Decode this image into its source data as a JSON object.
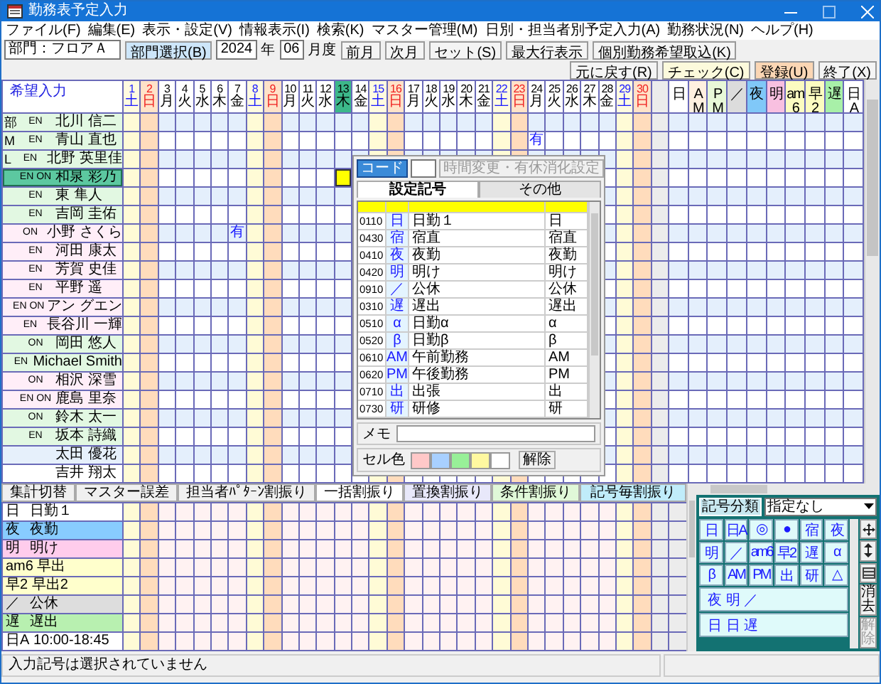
{
  "window": {
    "title": "勤務表予定入力"
  },
  "menu": [
    "ファイル(F)",
    "編集(E)",
    "表示・設定(V)",
    "情報表示(I)",
    "検索(K)",
    "マスター管理(M)",
    "日別・担当者別予定入力(A)",
    "勤務状況(N)",
    "ヘルプ(H)"
  ],
  "toolbar": {
    "department": "部門：フロアＡ",
    "department_button": {
      "label": "部門選択(B)",
      "color": "#cde6fa"
    },
    "year": "2024",
    "year_unit": "年",
    "month": "06",
    "month_unit": "月度",
    "nav_buttons": [
      "前月",
      "次月",
      "セット(S)",
      "最大行表示",
      "個別勤務希望取込(K)"
    ],
    "action_buttons": [
      {
        "label": "元に戻す(R)",
        "color": "#f4f4f4"
      },
      {
        "label": "チェック(C)",
        "color": "#fcfadc"
      },
      {
        "label": "登録(U)",
        "color": "#fbd6b4"
      },
      {
        "label": "終了(X)",
        "color": "#f4f4f4"
      }
    ]
  },
  "grid": {
    "corner_label": "希望入力",
    "days": [
      {
        "day": "1",
        "weekday": "土",
        "kind": "sat",
        "selected": false
      },
      {
        "day": "2",
        "weekday": "日",
        "kind": "sun",
        "selected": false
      },
      {
        "day": "3",
        "weekday": "月",
        "kind": "weekday",
        "selected": false
      },
      {
        "day": "4",
        "weekday": "火",
        "kind": "weekday",
        "selected": false
      },
      {
        "day": "5",
        "weekday": "水",
        "kind": "weekday",
        "selected": false
      },
      {
        "day": "6",
        "weekday": "木",
        "kind": "weekday",
        "selected": false
      },
      {
        "day": "7",
        "weekday": "金",
        "kind": "weekday",
        "selected": false
      },
      {
        "day": "8",
        "weekday": "土",
        "kind": "sat",
        "selected": false
      },
      {
        "day": "9",
        "weekday": "日",
        "kind": "sun",
        "selected": false
      },
      {
        "day": "10",
        "weekday": "月",
        "kind": "weekday",
        "selected": false
      },
      {
        "day": "11",
        "weekday": "火",
        "kind": "weekday",
        "selected": false
      },
      {
        "day": "12",
        "weekday": "水",
        "kind": "weekday",
        "selected": false
      },
      {
        "day": "13",
        "weekday": "木",
        "kind": "weekday",
        "selected": true
      },
      {
        "day": "14",
        "weekday": "金",
        "kind": "weekday",
        "selected": false
      },
      {
        "day": "15",
        "weekday": "土",
        "kind": "sat",
        "selected": false
      },
      {
        "day": "16",
        "weekday": "日",
        "kind": "sun",
        "selected": false
      },
      {
        "day": "17",
        "weekday": "月",
        "kind": "weekday",
        "selected": false
      },
      {
        "day": "18",
        "weekday": "火",
        "kind": "weekday",
        "selected": false
      },
      {
        "day": "19",
        "weekday": "水",
        "kind": "weekday",
        "selected": false
      },
      {
        "day": "20",
        "weekday": "木",
        "kind": "weekday",
        "selected": false
      },
      {
        "day": "21",
        "weekday": "金",
        "kind": "weekday",
        "selected": false
      },
      {
        "day": "22",
        "weekday": "土",
        "kind": "sat",
        "selected": false
      },
      {
        "day": "23",
        "weekday": "日",
        "kind": "sun",
        "selected": false
      },
      {
        "day": "24",
        "weekday": "月",
        "kind": "weekday",
        "selected": false
      },
      {
        "day": "25",
        "weekday": "火",
        "kind": "weekday",
        "selected": false
      },
      {
        "day": "26",
        "weekday": "水",
        "kind": "weekday",
        "selected": false
      },
      {
        "day": "27",
        "weekday": "木",
        "kind": "weekday",
        "selected": false
      },
      {
        "day": "28",
        "weekday": "金",
        "kind": "weekday",
        "selected": false
      },
      {
        "day": "29",
        "weekday": "土",
        "kind": "sat",
        "selected": false
      },
      {
        "day": "30",
        "weekday": "日",
        "kind": "sun",
        "selected": false
      }
    ],
    "summary_columns": [
      {
        "label": "日",
        "color": "#ffffff"
      },
      {
        "label": "AM",
        "color": "#fff0e0"
      },
      {
        "label": "PM",
        "color": "#e8f8d8"
      },
      {
        "label": "／",
        "color": "#dcdcdc"
      },
      {
        "label": "夜",
        "color": "#80c8f8"
      },
      {
        "label": "明",
        "color": "#f8c0e0"
      },
      {
        "label": "am6",
        "color": "#fcfcc0"
      },
      {
        "label": "早2",
        "color": "#fcfcc0"
      },
      {
        "label": "遅",
        "color": "#a8f0a8"
      },
      {
        "label": "日A",
        "color": "#ffffff"
      }
    ],
    "staff": [
      {
        "role": "部",
        "tags": "EN",
        "name": "北川 信二",
        "color": "#e2f8e2",
        "selected": false
      },
      {
        "role": "M",
        "tags": "EN",
        "name": "青山 直也",
        "color": "#e2f8e2",
        "selected": false,
        "requests": {
          "24": "有"
        }
      },
      {
        "role": "L",
        "tags": "EN",
        "name": "北野 英里佳",
        "color": "#e2f8e2",
        "selected": false
      },
      {
        "tags": "EN ON",
        "name": "和泉 彩乃",
        "selected": true
      },
      {
        "tags": "EN",
        "name": "東 隼人",
        "color": "#e2f8e2",
        "selected": false
      },
      {
        "tags": "EN",
        "name": "吉岡 圭佑",
        "color": "#e2f8e2",
        "selected": false
      },
      {
        "tags": "ON",
        "name": "小野 さくら",
        "color": "#ffeef8",
        "selected": false,
        "requests": {
          "7": "有"
        }
      },
      {
        "tags": "EN",
        "name": "河田 康太",
        "color": "#ffeef8",
        "selected": false
      },
      {
        "tags": "EN",
        "name": "芳賀 史佳",
        "color": "#ffeef8",
        "selected": false
      },
      {
        "tags": "EN",
        "name": "平野 遥",
        "color": "#ffeef8",
        "selected": false
      },
      {
        "tags": "EN ON",
        "name": "アン グエン",
        "color": "#ffeef8",
        "selected": false
      },
      {
        "tags": "EN",
        "name": "長谷川 一輝",
        "color": "#ffeef8",
        "selected": false
      },
      {
        "tags": "ON",
        "name": "岡田 悠人",
        "color": "#e2f8e2",
        "selected": false
      },
      {
        "tags": "EN",
        "name": "Michael Smith",
        "color": "#e2f8e2",
        "selected": false
      },
      {
        "tags": "ON",
        "name": "相沢 深雪",
        "color": "#ffeef8",
        "selected": false
      },
      {
        "tags": "EN ON",
        "name": "鹿島 里奈",
        "color": "#ffeef8",
        "selected": false
      },
      {
        "tags": "ON",
        "name": "鈴木 太一",
        "color": "#e2f8e2",
        "selected": false
      },
      {
        "tags": "EN",
        "name": "坂本 詩織",
        "color": "#e2f8e2",
        "selected": false
      },
      {
        "name": "太田 優花",
        "color": "#e6f0fb",
        "selected": false
      },
      {
        "name": "吉井 翔太",
        "color": "#ffffff",
        "selected": false
      }
    ]
  },
  "popup": {
    "code_button": "コード",
    "settings_button": {
      "label": "時間変更・有休消化設定",
      "disabled": true
    },
    "tabs": [
      {
        "label": "設定記号",
        "selected": true
      },
      {
        "label": "その他",
        "selected": false
      }
    ],
    "codes": [
      {
        "code": "0110",
        "symbol": "日",
        "name": "日勤１",
        "short": "日"
      },
      {
        "code": "0430",
        "symbol": "宿",
        "name": "宿直",
        "short": "宿直"
      },
      {
        "code": "0410",
        "symbol": "夜",
        "name": "夜勤",
        "short": "夜勤"
      },
      {
        "code": "0420",
        "symbol": "明",
        "name": "明け",
        "short": "明け"
      },
      {
        "code": "0910",
        "symbol": "／",
        "name": "公休",
        "short": "公休"
      },
      {
        "code": "0310",
        "symbol": "遅",
        "name": "遅出",
        "short": "遅出"
      },
      {
        "code": "0510",
        "symbol": "α",
        "name": "日勤α",
        "short": "α"
      },
      {
        "code": "0520",
        "symbol": "β",
        "name": "日勤β",
        "short": "β"
      },
      {
        "code": "0610",
        "symbol": "AM",
        "name": "午前勤務",
        "short": "AM"
      },
      {
        "code": "0620",
        "symbol": "PM",
        "name": "午後勤務",
        "short": "PM"
      },
      {
        "code": "0710",
        "symbol": "出",
        "name": "出張",
        "short": "出"
      },
      {
        "code": "0730",
        "symbol": "研",
        "name": "研修",
        "short": "研"
      }
    ],
    "memo_label": "メモ",
    "cell_color_label": "セル色",
    "cell_colors": [
      {
        "color": "#ffc8c8"
      },
      {
        "color": "#a8d0ff"
      },
      {
        "color": "#98f098"
      },
      {
        "color": "#fff8a0"
      },
      {
        "color": "#ffffff"
      }
    ],
    "clear_button": "解除"
  },
  "bottom_tabs": [
    {
      "label": "集計切替",
      "color": "#f0f0f0"
    },
    {
      "label": "マスター誤差",
      "color": "#f0f0f0"
    },
    {
      "label": "担当者ﾊﾟﾀｰﾝ割振り",
      "color": "#f0f0f0"
    },
    {
      "label": "一括割振り",
      "color": "#ffffff"
    },
    {
      "label": "置換割振り",
      "color": "#e8e8fa"
    },
    {
      "label": "条件割振り",
      "color": "#e0f8d8"
    },
    {
      "label": "記号毎割振り",
      "color": "#c0ecfa"
    }
  ],
  "summary_rows": [
    {
      "code": "日",
      "label": "日勤１",
      "color": "#ffffff"
    },
    {
      "code": "夜",
      "label": "夜勤",
      "color": "#88ccff"
    },
    {
      "code": "明",
      "label": "明け",
      "color": "#ffccec"
    },
    {
      "code": "am6",
      "label": "早出",
      "color": "#ffffcc"
    },
    {
      "code": "早2",
      "label": "早出2",
      "color": "#ffffcc"
    },
    {
      "code": "／",
      "label": "公休",
      "color": "#dddddd"
    },
    {
      "code": "遅",
      "label": "遅出",
      "color": "#b8f0b0"
    },
    {
      "code": "日A",
      "label": "10:00-18:45",
      "color": "#ffffff"
    }
  ],
  "palette": {
    "category_label": "記号分類",
    "category_value": "指定なし",
    "symbols": [
      "日",
      "日A",
      "◎",
      "●",
      "宿",
      "夜",
      "明",
      "／",
      "am6",
      "早2",
      "遅",
      "α",
      "β",
      "AM",
      "PM",
      "出",
      "研",
      "△"
    ],
    "patterns": [
      "夜 明 ／",
      "日 日 遅"
    ],
    "tools": [
      {
        "kind": "move"
      },
      {
        "kind": "resize"
      },
      {
        "kind": "grid"
      },
      {
        "kind": "text",
        "label": "消去",
        "disabled": false
      },
      {
        "kind": "text",
        "label": "解除",
        "disabled": true
      }
    ]
  },
  "status": {
    "message": "入力記号は選択されていません"
  }
}
